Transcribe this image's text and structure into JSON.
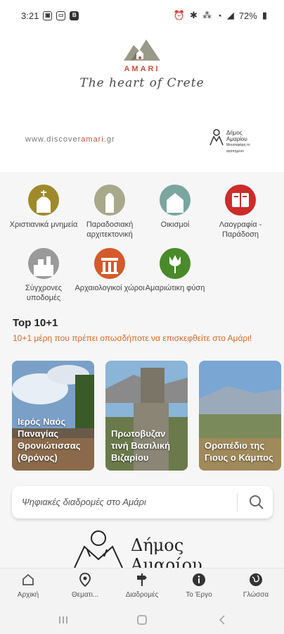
{
  "status": {
    "time": "3:21",
    "battery": "72%"
  },
  "brand": {
    "name": "AMARI",
    "tagline": "The heart of Crete",
    "site_prefix": "www.discover",
    "site_accent": "amari",
    "site_suffix": ".gr",
    "muni_small_1": "Δήμος",
    "muni_small_2": "Αμαρίου",
    "muni_small_3": "Μουσαφάρη το αγαπημένο"
  },
  "categories": [
    {
      "label": "Χριστιανικά μνημεία",
      "color": "#9e8a2c",
      "icon": "church-icon"
    },
    {
      "label": "Παραδοσιακή αρχιτεκτονική",
      "color": "#a8a88a",
      "icon": "arch-icon"
    },
    {
      "label": "Οικισμοί",
      "color": "#7aa6a0",
      "icon": "house-icon"
    },
    {
      "label": "Λαογραφία - Παράδοση",
      "color": "#cc2b2b",
      "icon": "book-icon"
    },
    {
      "label": "Σύγχρονες υποδομές",
      "color": "#9a9a9a",
      "icon": "building-icon"
    },
    {
      "label": "Αρχαιολογικοί χώροι",
      "color": "#d45a2a",
      "icon": "temple-icon"
    },
    {
      "label": "Αμαριώτικη φύση",
      "color": "#4a8a2a",
      "icon": "tulip-icon"
    }
  ],
  "top": {
    "title": "Top 10+1",
    "subtitle": "10+1 μέρη που πρέπει οπωσδήποτε να επισκεφθείτε στο Αμάρι!"
  },
  "cards": [
    {
      "title": "Ιερός Ναός Παναγίας Θρονιώτισσας (Θρόνος)"
    },
    {
      "title": "Πρωτοβυζαν τινή Βασιλική Βιζαρίου"
    },
    {
      "title": "Οροπέδιο της Γιους ο Κάμπος"
    }
  ],
  "search": {
    "placeholder": "Ψηφιακές διαδρομές στο Αμάρι"
  },
  "footer": {
    "muni_line1": "Δήμος",
    "muni_line2": "Αμαρίου"
  },
  "tabs": [
    {
      "label": "Αρχική",
      "icon": "home-icon"
    },
    {
      "label": "Θεματι...",
      "icon": "map-pin-icon"
    },
    {
      "label": "Διαδρομές",
      "icon": "signpost-icon"
    },
    {
      "label": "Το Έργο",
      "icon": "info-icon"
    },
    {
      "label": "Γλώσσα",
      "icon": "globe-icon"
    }
  ]
}
